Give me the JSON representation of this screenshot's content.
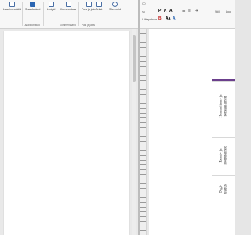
{
  "left_window": {
    "ribbon_buttons": [
      {
        "label": "Laadimesoklid",
        "icon": "footer-icon"
      },
      {
        "label": "Sisaldusked",
        "icon": "table-of-contents-icon"
      },
      {
        "label": "Linigid",
        "icon": "links-icon"
      },
      {
        "label": "Kommentaar",
        "icon": "comment-icon"
      },
      {
        "label": "Pais ja jalus",
        "icon": "header-footer-icon"
      },
      {
        "label": "Tekst",
        "icon": "text-box-icon"
      },
      {
        "label": "Sümbolid",
        "icon": "symbol-icon"
      }
    ],
    "group_labels": [
      "Laaditööriistad",
      "Kommentaarid",
      "Pais ja jalus"
    ]
  },
  "right_window": {
    "ribbon_glyphs": [
      "P",
      "K",
      "A",
      "B",
      "Aa",
      "A"
    ],
    "ribbon_side_labels": [
      "Stiil",
      "Loo"
    ],
    "section_label": "Lõikepuhver",
    "table_cells": [
      {
        "text": "Humanitaar- ja ",
        "text2": "sotsiaalained"
      },
      {
        "text": "Reaal- ja ",
        "text2": "loodusained"
      },
      {
        "text": "Digi-",
        "text2": "teadus"
      }
    ]
  },
  "colors": {
    "accent_purple": "#6b3f8c",
    "ribbon_blue": "#2b66b3"
  }
}
